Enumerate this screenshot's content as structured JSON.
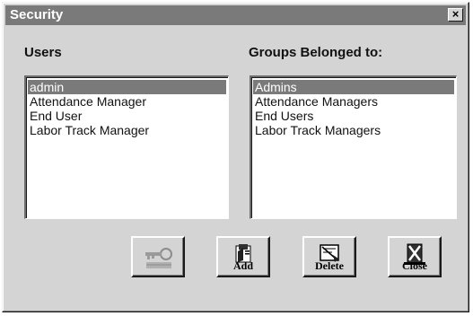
{
  "window": {
    "title": "Security",
    "close_glyph": "×"
  },
  "users": {
    "label": "Users",
    "items": [
      "admin",
      "Attendance Manager",
      "End User",
      "Labor Track Manager"
    ],
    "selected": "admin"
  },
  "groups": {
    "label": "Groups Belonged to:",
    "items": [
      "Admins",
      "Attendance Managers",
      "End Users",
      "Labor Track Managers"
    ],
    "selected": "Admins"
  },
  "buttons": {
    "password": {
      "icon": "key-icon"
    },
    "add": {
      "label": "Add",
      "icon": "add-user-icon"
    },
    "delete": {
      "label": "Delete",
      "icon": "delete-user-icon"
    },
    "close": {
      "label": "Close",
      "icon": "close-door-icon"
    }
  },
  "colors": {
    "selection": "#7a7a7a",
    "titlebar": "#7a7a7a",
    "face": "#d4d4d4"
  }
}
